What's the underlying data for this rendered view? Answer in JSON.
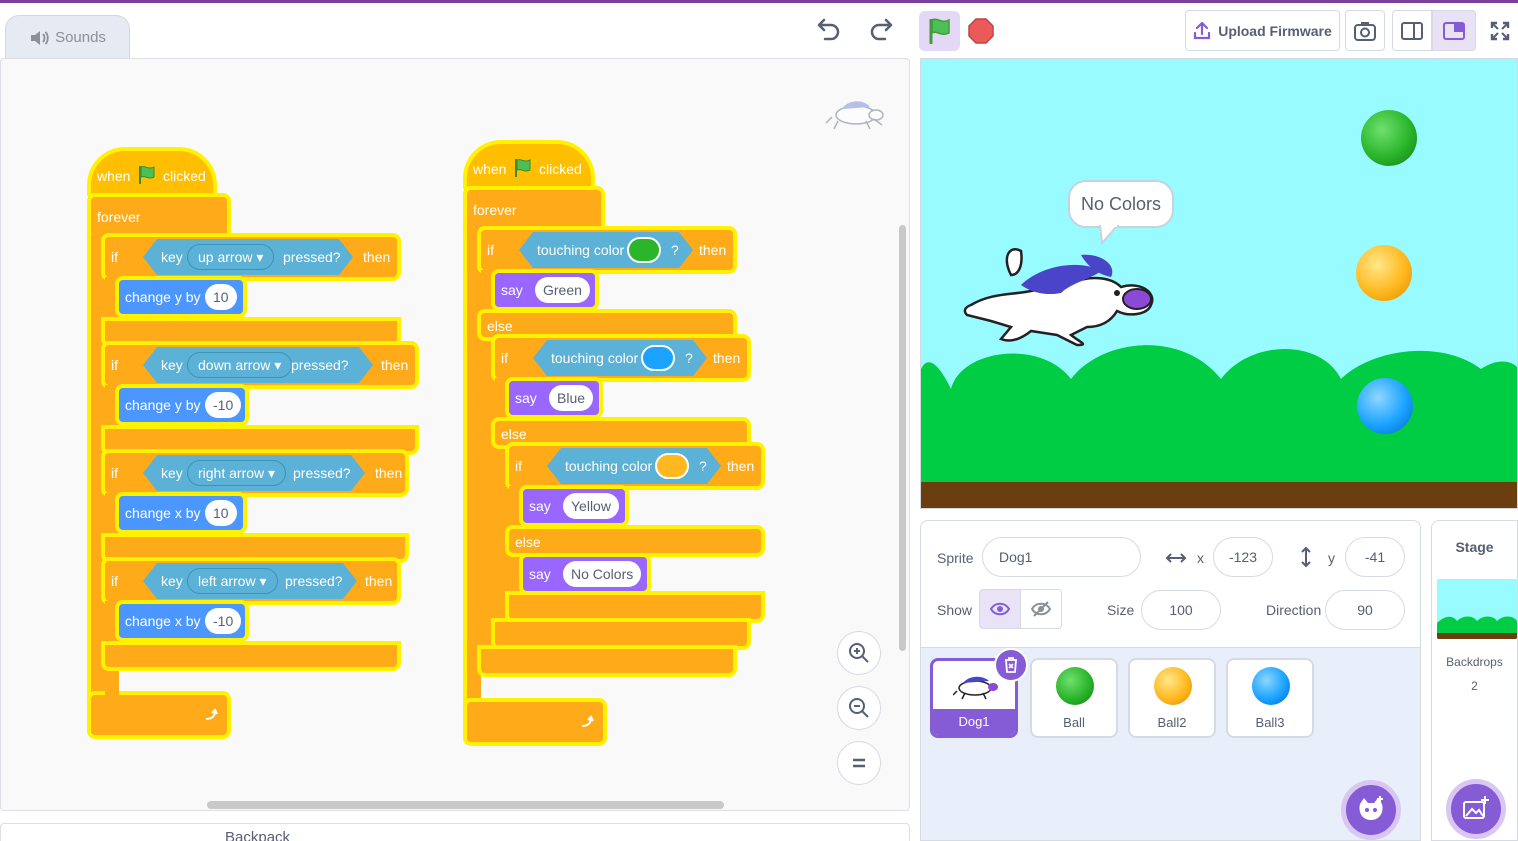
{
  "tabs": {
    "sounds_label": "Sounds"
  },
  "toolbar": {
    "upload_firmware": "Upload Firmware",
    "undo_icon": "undo-icon",
    "redo_icon": "redo-icon"
  },
  "backpack": {
    "label": "Backpack"
  },
  "script1": {
    "when": "when",
    "clicked": "clicked",
    "forever": "forever",
    "if": "if",
    "key": "key",
    "pressed": "pressed?",
    "then": "then",
    "up_arrow": "up arrow",
    "down_arrow": "down arrow",
    "right_arrow": "right arrow",
    "left_arrow": "left arrow",
    "change_y": "change y by",
    "change_x": "change x by",
    "v1": "10",
    "v2": "-10",
    "v3": "10",
    "v4": "-10"
  },
  "script2": {
    "when": "when",
    "clicked": "clicked",
    "forever": "forever",
    "if": "if",
    "else": "else",
    "then": "then",
    "touching_color": "touching color",
    "q": "?",
    "say": "say",
    "green": "Green",
    "blue": "Blue",
    "yellow": "Yellow",
    "no_colors": "No Colors",
    "color_green": "#2ab52a",
    "color_blue": "#1aa3ff",
    "color_yellow": "#ffb81f"
  },
  "stage": {
    "speech": "No Colors"
  },
  "sprite_info": {
    "sprite_label": "Sprite",
    "sprite_name": "Dog1",
    "x_label": "x",
    "x_value": "-123",
    "y_label": "y",
    "y_value": "-41",
    "show_label": "Show",
    "size_label": "Size",
    "size_value": "100",
    "direction_label": "Direction",
    "direction_value": "90"
  },
  "sprites": [
    {
      "name": "Dog1",
      "selected": true
    },
    {
      "name": "Ball",
      "selected": false
    },
    {
      "name": "Ball2",
      "selected": false
    },
    {
      "name": "Ball3",
      "selected": false
    }
  ],
  "stage_panel": {
    "title": "Stage",
    "backdrops_label": "Backdrops",
    "backdrops_count": "2"
  },
  "colors": {
    "accent": "#855cd6",
    "events": "#ffbf00",
    "control": "#ffab19",
    "sensing": "#5cb1d6",
    "motion": "#4c97ff",
    "looks": "#9966ff",
    "glow": "#fff200"
  }
}
